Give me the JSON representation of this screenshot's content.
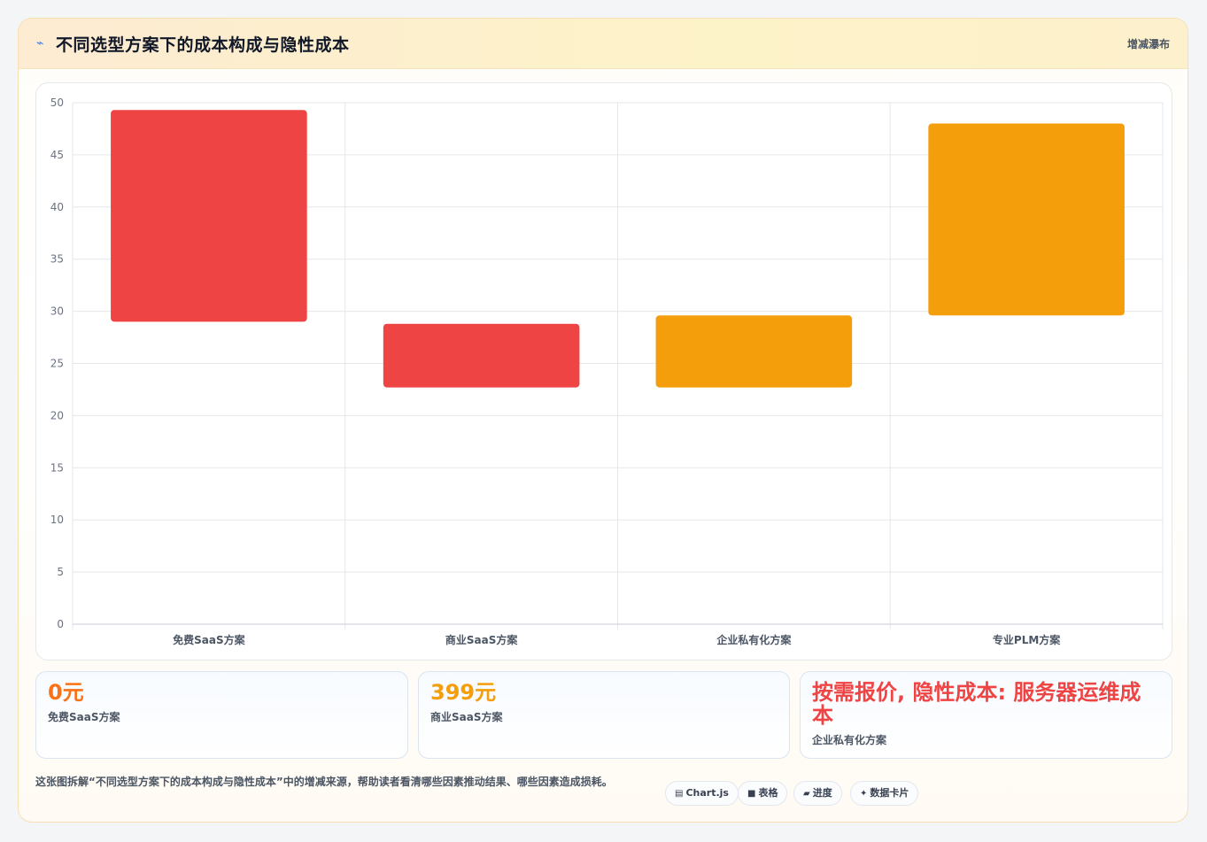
{
  "header": {
    "icon": "chart-pulse-icon",
    "title": "不同选型方案下的成本构成与隐性成本",
    "tag": "增减瀑布"
  },
  "chart_data": {
    "type": "bar",
    "subtype": "floating-waterfall",
    "categories": [
      "免费SaaS方案",
      "商业SaaS方案",
      "企业私有化方案",
      "专业PLM方案"
    ],
    "ranges": [
      [
        29,
        49.3
      ],
      [
        22.7,
        28.8
      ],
      [
        22.7,
        29.6
      ],
      [
        29.6,
        48
      ]
    ],
    "colors": [
      "#ef4444",
      "#ef4444",
      "#f59e0b",
      "#f59e0b"
    ],
    "ylim": [
      0,
      50
    ],
    "yticks": [
      0,
      5,
      10,
      15,
      20,
      25,
      30,
      35,
      40,
      45,
      50
    ],
    "grid": true,
    "legend": "none",
    "title": "",
    "xlabel": "",
    "ylabel": ""
  },
  "stats": [
    {
      "value": "0元",
      "label": "免费SaaS方案",
      "color": "#f97316"
    },
    {
      "value": "399元",
      "label": "商业SaaS方案",
      "color": "#f59e0b"
    },
    {
      "value": "按需报价, 隐性成本: 服务器运维成本",
      "label": "企业私有化方案",
      "color": "#ef4444"
    }
  ],
  "footer": {
    "description": "这张图拆解“不同选型方案下的成本构成与隐性成本”中的增减来源，帮助读者看清哪些因素推动结果、哪些因素造成损耗。",
    "chips": [
      {
        "icon": "chart-icon",
        "glyph": "▤",
        "label": "Chart.js"
      },
      {
        "icon": "table-icon",
        "glyph": "■",
        "label": "表格"
      },
      {
        "icon": "progress-icon",
        "glyph": "▰",
        "label": "进度"
      },
      {
        "icon": "sparkle-icon",
        "glyph": "✦",
        "label": "数据卡片"
      }
    ]
  }
}
